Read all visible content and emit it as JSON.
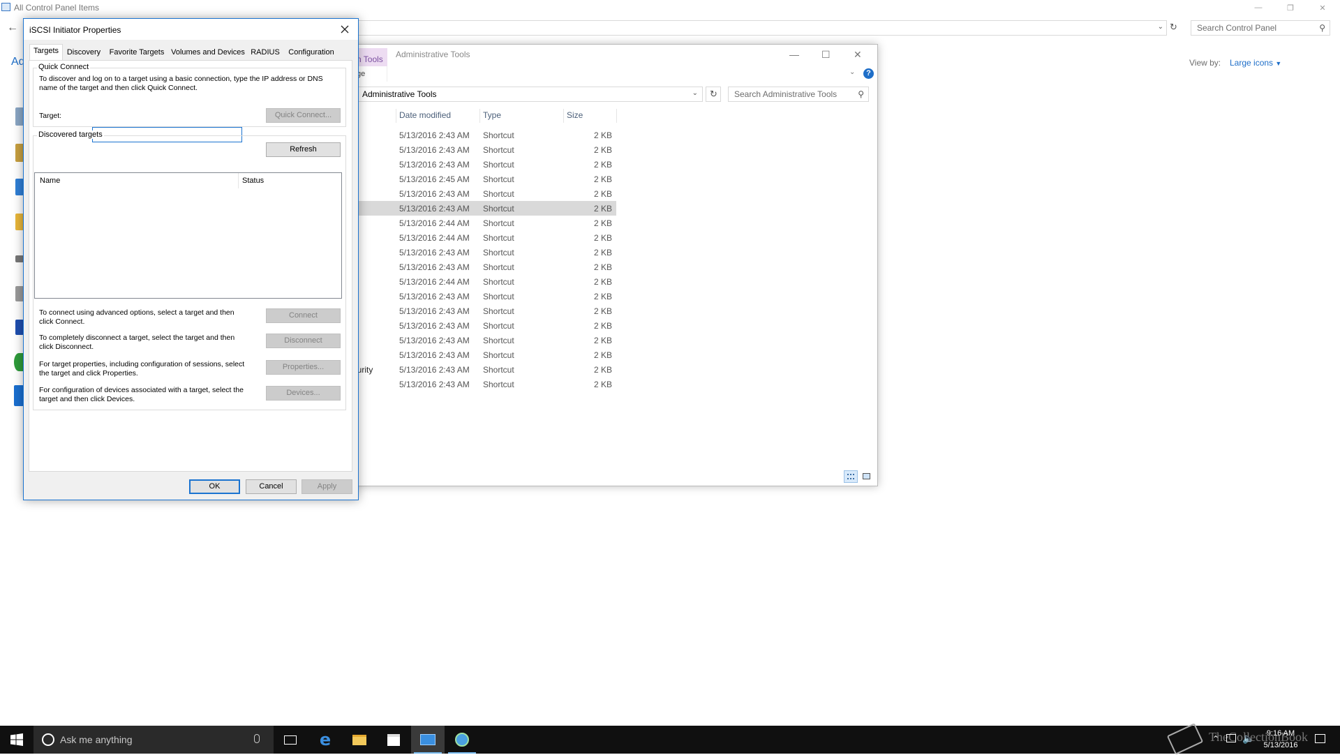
{
  "control_panel": {
    "title": "All Control Panel Items",
    "heading_partial": "Ad",
    "search_placeholder": "Search Control Panel",
    "view_by_label": "View by:",
    "view_by_value": "Large icons"
  },
  "admin_tools": {
    "ribbon_tab": "n Tools",
    "ribbon_sub": "ge",
    "title": "Administrative Tools",
    "address": "Administrative Tools",
    "search_placeholder": "Search Administrative Tools",
    "columns": [
      "Date modified",
      "Type",
      "Size"
    ],
    "rows": [
      {
        "name": "",
        "date": "5/13/2016 2:43 AM",
        "type": "Shortcut",
        "size": "2 KB"
      },
      {
        "name": "",
        "date": "5/13/2016 2:43 AM",
        "type": "Shortcut",
        "size": "2 KB"
      },
      {
        "name": "",
        "date": "5/13/2016 2:43 AM",
        "type": "Shortcut",
        "size": "2 KB"
      },
      {
        "name": "",
        "date": "5/13/2016 2:45 AM",
        "type": "Shortcut",
        "size": "2 KB"
      },
      {
        "name": "",
        "date": "5/13/2016 2:43 AM",
        "type": "Shortcut",
        "size": "2 KB"
      },
      {
        "name": "",
        "date": "5/13/2016 2:43 AM",
        "type": "Shortcut",
        "size": "2 KB",
        "selected": true
      },
      {
        "name": "",
        "date": "5/13/2016 2:44 AM",
        "type": "Shortcut",
        "size": "2 KB"
      },
      {
        "name": "",
        "date": "5/13/2016 2:44 AM",
        "type": "Shortcut",
        "size": "2 KB"
      },
      {
        "name": "",
        "date": "5/13/2016 2:43 AM",
        "type": "Shortcut",
        "size": "2 KB"
      },
      {
        "name": "",
        "date": "5/13/2016 2:43 AM",
        "type": "Shortcut",
        "size": "2 KB"
      },
      {
        "name": "",
        "date": "5/13/2016 2:44 AM",
        "type": "Shortcut",
        "size": "2 KB"
      },
      {
        "name": "",
        "date": "5/13/2016 2:43 AM",
        "type": "Shortcut",
        "size": "2 KB"
      },
      {
        "name": "",
        "date": "5/13/2016 2:43 AM",
        "type": "Shortcut",
        "size": "2 KB"
      },
      {
        "name": "",
        "date": "5/13/2016 2:43 AM",
        "type": "Shortcut",
        "size": "2 KB"
      },
      {
        "name": "",
        "date": "5/13/2016 2:43 AM",
        "type": "Shortcut",
        "size": "2 KB"
      },
      {
        "name": "",
        "date": "5/13/2016 2:43 AM",
        "type": "Shortcut",
        "size": "2 KB"
      },
      {
        "name": "ecurity",
        "date": "5/13/2016 2:43 AM",
        "type": "Shortcut",
        "size": "2 KB"
      },
      {
        "name": "",
        "date": "5/13/2016 2:43 AM",
        "type": "Shortcut",
        "size": "2 KB"
      }
    ]
  },
  "dialog": {
    "title": "iSCSI Initiator Properties",
    "tabs": [
      "Targets",
      "Discovery",
      "Favorite Targets",
      "Volumes and Devices",
      "RADIUS",
      "Configuration"
    ],
    "quick_connect": {
      "label": "Quick Connect",
      "description": "To discover and log on to a target using a basic connection, type the IP address or DNS name of the target and then click Quick Connect.",
      "target_label": "Target:",
      "target_value": "",
      "button": "Quick Connect..."
    },
    "discovered": {
      "label": "Discovered targets",
      "refresh": "Refresh",
      "col_name": "Name",
      "col_status": "Status"
    },
    "actions": [
      {
        "text": "To connect using advanced options, select a target and then click Connect.",
        "button": "Connect"
      },
      {
        "text": "To completely disconnect a target, select the target and then click Disconnect.",
        "button": "Disconnect"
      },
      {
        "text": "For target properties, including configuration of sessions, select the target and click Properties.",
        "button": "Properties..."
      },
      {
        "text": "For configuration of devices associated with a target, select the target and then click Devices.",
        "button": "Devices..."
      }
    ],
    "ok": "OK",
    "cancel": "Cancel",
    "apply": "Apply"
  },
  "taskbar": {
    "search_placeholder": "Ask me anything",
    "time": "9:16 AM",
    "date": "5/13/2016",
    "watermark": "TheCollectionBook"
  },
  "colors": {
    "accent": "#1a73d0",
    "taskbar": "#101010",
    "selected_row": "#d9d9d9"
  }
}
